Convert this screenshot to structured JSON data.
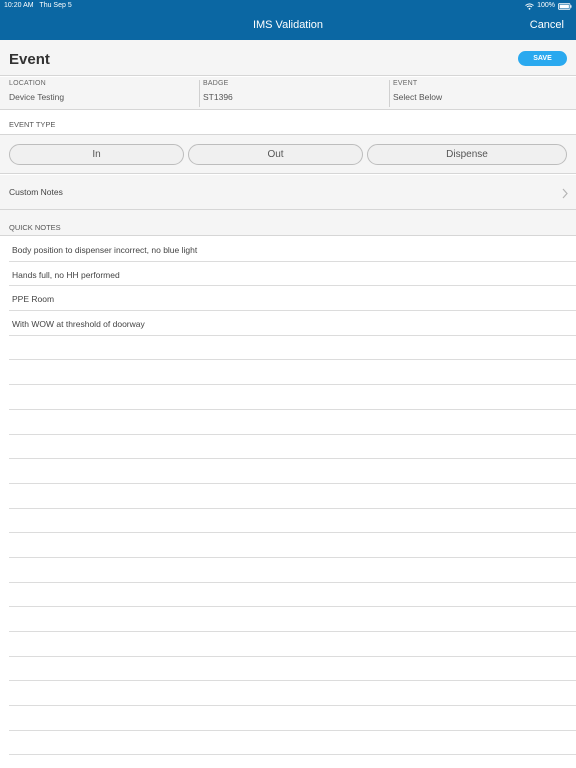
{
  "status_bar": {
    "time": "10:20 AM",
    "date": "Thu Sep 5",
    "battery": "100%"
  },
  "nav": {
    "title": "IMS Validation",
    "cancel_label": "Cancel"
  },
  "event_header": {
    "title": "Event",
    "save_label": "SAVE"
  },
  "info": {
    "location_label": "LOCATION",
    "location_value": "Device Testing",
    "badge_label": "BADGE",
    "badge_value": "ST1396",
    "event_label": "EVENT",
    "event_value": "Select Below"
  },
  "event_type": {
    "header": "EVENT TYPE",
    "options": [
      "In",
      "Out",
      "Dispense"
    ]
  },
  "custom_notes": {
    "label": "Custom Notes"
  },
  "quick_notes": {
    "header": "QUICK NOTES",
    "items": [
      "Body position to dispenser incorrect, no blue light",
      "Hands full, no HH performed",
      "PPE Room",
      "With WOW at threshold of doorway"
    ],
    "empty_rows": 17
  },
  "colors": {
    "header_blue": "#0b67a3",
    "save_blue": "#2aa9ef",
    "panel_bg": "#f5f5f5"
  }
}
